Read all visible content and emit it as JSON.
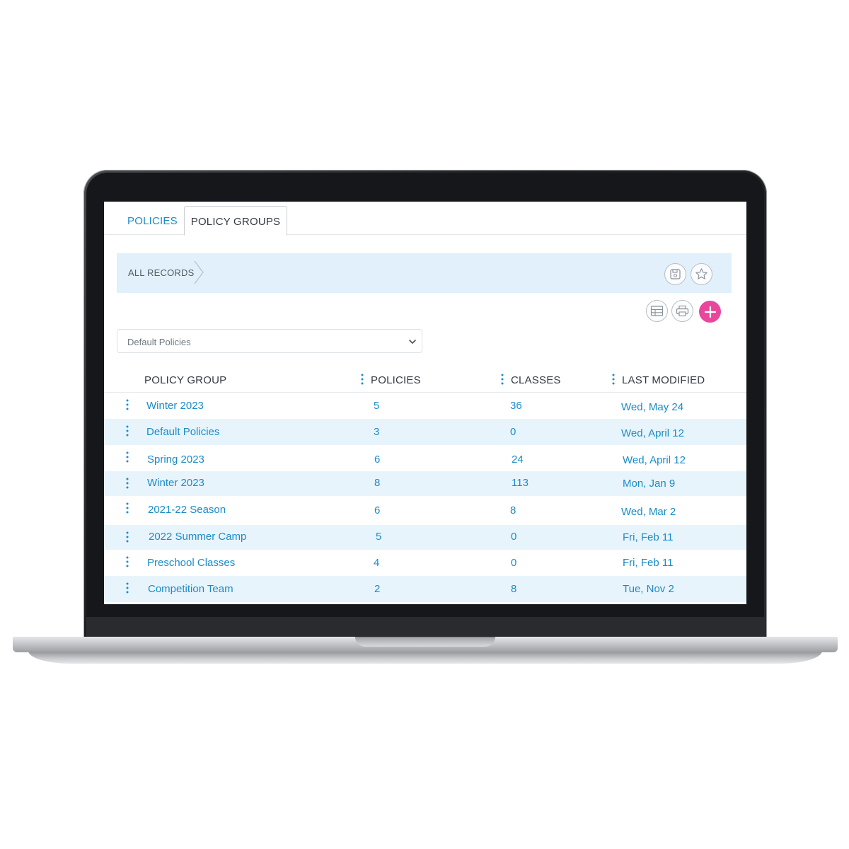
{
  "tabs": [
    {
      "label": "POLICIES",
      "active": false
    },
    {
      "label": "POLICY GROUPS",
      "active": true
    }
  ],
  "breadcrumb": {
    "label": "ALL RECORDS"
  },
  "toolbar_icons": [
    "save-icon",
    "star-icon",
    "table-icon",
    "print-icon",
    "plus-icon"
  ],
  "filter": {
    "selected": "Default Policies"
  },
  "table": {
    "columns": [
      "POLICY GROUP",
      "POLICIES",
      "CLASSES",
      "LAST MODIFIED"
    ],
    "rows": [
      {
        "name": "Winter 2023",
        "policies": "5",
        "classes": "36",
        "modified": "Wed, May 24"
      },
      {
        "name": "Default Policies",
        "policies": "3",
        "classes": "0",
        "modified": "Wed, April 12"
      },
      {
        "name": "Spring 2023",
        "policies": "6",
        "classes": "24",
        "modified": "Wed, April 12"
      },
      {
        "name": "Winter 2023",
        "policies": "8",
        "classes": "113",
        "modified": "Mon, Jan 9"
      },
      {
        "name": "2021-22 Season",
        "policies": "6",
        "classes": "8",
        "modified": "Wed, Mar 2"
      },
      {
        "name": "2022 Summer Camp",
        "policies": "5",
        "classes": "0",
        "modified": "Fri, Feb 11"
      },
      {
        "name": "Preschool Classes",
        "policies": "4",
        "classes": "0",
        "modified": "Fri, Feb 11"
      },
      {
        "name": "Competition Team",
        "policies": "2",
        "classes": "8",
        "modified": "Tue, Nov 2"
      }
    ]
  },
  "colors": {
    "link": "#1a8cc9",
    "accent_add": "#e8479c",
    "crumbbar_bg": "#e1f0fa",
    "row_alt_bg": "#e8f4fb"
  }
}
